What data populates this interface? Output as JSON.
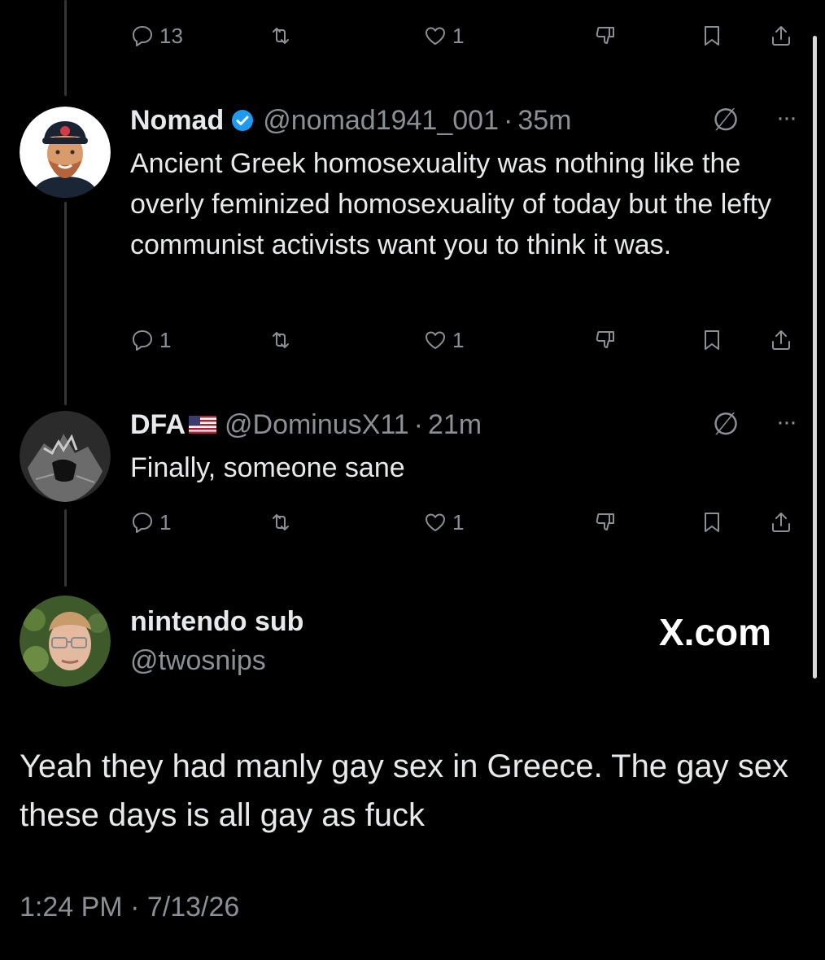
{
  "top_actions": {
    "replies": "13",
    "retweets": "",
    "likes": "1"
  },
  "reply1": {
    "display_name": "Nomad",
    "handle": "@nomad1941_001",
    "separator": "·",
    "time": "35m",
    "text": "Ancient Greek homosexuality was nothing like the overly feminized homosexuality of today but the lefty communist activists want you to think it was.",
    "actions": {
      "replies": "1",
      "retweets": "",
      "likes": "1"
    }
  },
  "reply2": {
    "display_name": "DFA",
    "handle": "@DominusX11",
    "separator": "·",
    "time": "21m",
    "text": "Finally, someone sane",
    "actions": {
      "replies": "1",
      "retweets": "",
      "likes": "1"
    }
  },
  "main_tweet": {
    "display_name": "nintendo sub",
    "handle": "@twosnips",
    "site_label": "X.com",
    "text": "Yeah they had manly gay sex in Greece. The gay sex these days is all gay as fuck",
    "timestamp": "1:24 PM · 7/13/26"
  },
  "icons": {
    "grok": "∅",
    "more": "···"
  },
  "colors": {
    "background": "#000000",
    "text": "#e7e9ea",
    "muted": "#8b9095",
    "verified": "#1d9bf0",
    "thread_line": "#333639"
  }
}
